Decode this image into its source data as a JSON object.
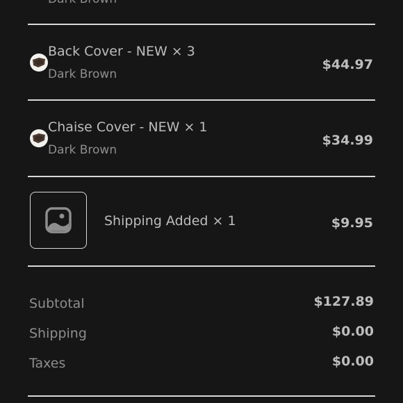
{
  "top_item": {
    "variant": "Dark Brown"
  },
  "items": [
    {
      "title": "Back Cover - NEW × 3",
      "variant": "Dark Brown",
      "price": "$44.97",
      "thumb_icon": "cushion-thumbnail"
    },
    {
      "title": "Chaise Cover - NEW × 1",
      "variant": "Dark Brown",
      "price": "$34.99",
      "thumb_icon": "cushion-thumbnail"
    },
    {
      "title": "Shipping Added × 1",
      "price": "$9.95",
      "thumb_icon": "image-placeholder-icon"
    }
  ],
  "summary": {
    "subtotal_label": "Subtotal",
    "subtotal_value": "$127.89",
    "shipping_label": "Shipping",
    "shipping_value": "$0.00",
    "taxes_label": "Taxes",
    "taxes_value": "$0.00"
  },
  "colors": {
    "background": "#161616",
    "divider": "#d9d9d9",
    "text_primary": "#bdbdbd",
    "text_secondary": "#8e8e8e"
  }
}
